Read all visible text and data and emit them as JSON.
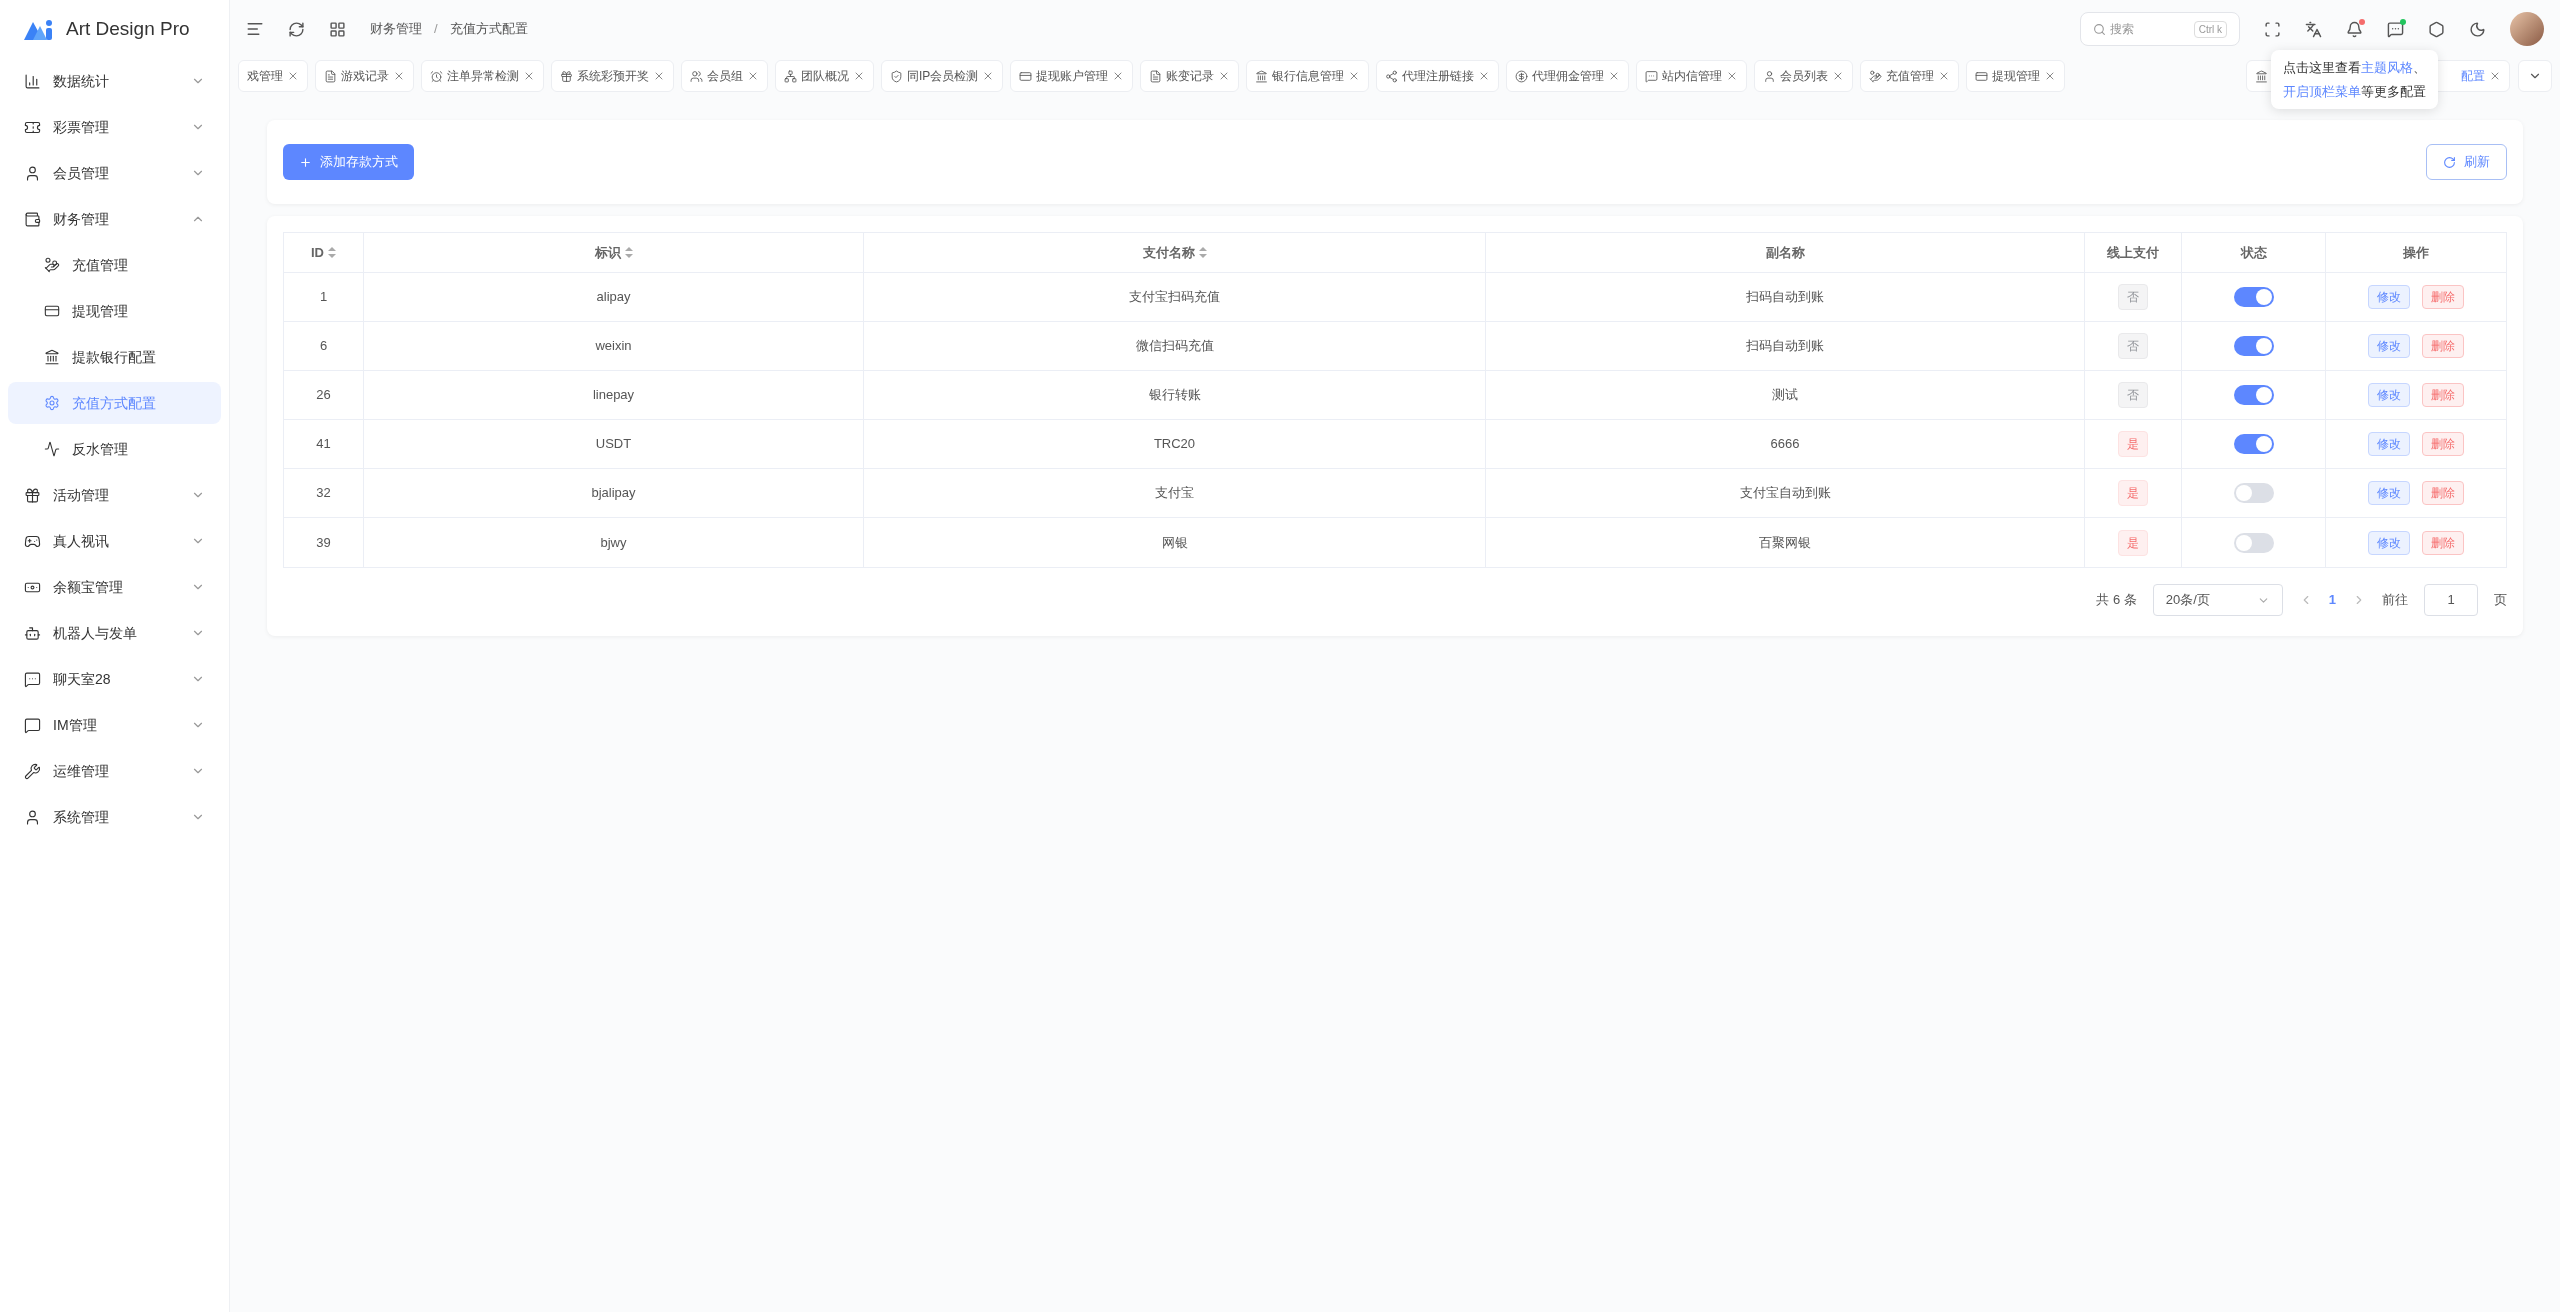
{
  "brand": {
    "name": "Art Design Pro"
  },
  "sidebar": {
    "items": [
      {
        "label": "数据统计",
        "expanded": false
      },
      {
        "label": "彩票管理",
        "expanded": false
      },
      {
        "label": "会员管理",
        "expanded": false
      },
      {
        "label": "财务管理",
        "expanded": true,
        "children": [
          {
            "label": "充值管理",
            "selected": false
          },
          {
            "label": "提现管理",
            "selected": false
          },
          {
            "label": "提款银行配置",
            "selected": false
          },
          {
            "label": "充值方式配置",
            "selected": true
          },
          {
            "label": "反水管理",
            "selected": false
          }
        ]
      },
      {
        "label": "活动管理",
        "expanded": false
      },
      {
        "label": "真人视讯",
        "expanded": false
      },
      {
        "label": "余额宝管理",
        "expanded": false
      },
      {
        "label": "机器人与发单",
        "expanded": false
      },
      {
        "label": "聊天室28",
        "expanded": false
      },
      {
        "label": "IM管理",
        "expanded": false
      },
      {
        "label": "运维管理",
        "expanded": false
      },
      {
        "label": "系统管理",
        "expanded": false
      }
    ]
  },
  "header": {
    "breadcrumb": [
      "财务管理",
      "充值方式配置"
    ],
    "separator": "/",
    "search": {
      "placeholder": "搜索",
      "shortcut": "Ctrl k"
    }
  },
  "tabs": [
    {
      "label": "戏管理",
      "selected": false
    },
    {
      "label": "游戏记录",
      "selected": false
    },
    {
      "label": "注单异常检测",
      "selected": false
    },
    {
      "label": "系统彩预开奖",
      "selected": false
    },
    {
      "label": "会员组",
      "selected": false
    },
    {
      "label": "团队概况",
      "selected": false
    },
    {
      "label": "同IP会员检测",
      "selected": false
    },
    {
      "label": "提现账户管理",
      "selected": false
    },
    {
      "label": "账变记录",
      "selected": false
    },
    {
      "label": "银行信息管理",
      "selected": false
    },
    {
      "label": "代理注册链接",
      "selected": false
    },
    {
      "label": "代理佣金管理",
      "selected": false
    },
    {
      "label": "站内信管理",
      "selected": false
    },
    {
      "label": "会员列表",
      "selected": false
    },
    {
      "label": "充值管理",
      "selected": false
    },
    {
      "label": "提现管理",
      "selected": false
    },
    {
      "selected": false
    },
    {
      "label": "配置",
      "selected": true
    }
  ],
  "tooltip": {
    "lines": [
      [
        {
          "text": "点击这里查看",
          "link": false
        },
        {
          "text": "主题风格",
          "link": true
        },
        {
          "text": "、",
          "link": false
        }
      ],
      [
        {
          "text": "开启顶栏菜单",
          "link": true
        },
        {
          "text": "等更多配置",
          "link": false
        }
      ]
    ]
  },
  "toolbar": {
    "add_button": "添加存款方式",
    "refresh_button": "刷新"
  },
  "table": {
    "columns": [
      {
        "label": "ID",
        "sortable": true
      },
      {
        "label": "标识",
        "sortable": true
      },
      {
        "label": "支付名称",
        "sortable": true
      },
      {
        "label": "副名称",
        "sortable": false
      },
      {
        "label": "线上支付",
        "sortable": false
      },
      {
        "label": "状态",
        "sortable": false
      },
      {
        "label": "操作",
        "sortable": false
      }
    ],
    "rows": [
      {
        "id": "1",
        "code": "alipay",
        "name": "支付宝扫码充值",
        "alias": "扫码自动到账",
        "online": {
          "label": "否",
          "on": false
        },
        "on": true,
        "actions": [
          "修改",
          "删除"
        ]
      },
      {
        "id": "6",
        "code": "weixin",
        "name": "微信扫码充值",
        "alias": "扫码自动到账",
        "online": {
          "label": "否",
          "on": false
        },
        "on": true,
        "actions": [
          "修改",
          "删除"
        ]
      },
      {
        "id": "26",
        "code": "linepay",
        "name": "银行转账",
        "alias": "测试",
        "online": {
          "label": "否",
          "on": false
        },
        "on": true,
        "actions": [
          "修改",
          "删除"
        ]
      },
      {
        "id": "41",
        "code": "USDT",
        "name": "TRC20",
        "alias": "6666",
        "online": {
          "label": "是",
          "on": true
        },
        "on": true,
        "actions": [
          "修改",
          "删除"
        ]
      },
      {
        "id": "32",
        "code": "bjalipay",
        "name": "支付宝",
        "alias": "支付宝自动到账",
        "online": {
          "label": "是",
          "on": true
        },
        "on": false,
        "actions": [
          "修改",
          "删除"
        ]
      },
      {
        "id": "39",
        "code": "bjwy",
        "name": "网银",
        "alias": "百聚网银",
        "online": {
          "label": "是",
          "on": true
        },
        "on": false,
        "actions": [
          "修改",
          "删除"
        ]
      }
    ]
  },
  "pagination": {
    "total": "共 6 条",
    "page_size": "20条/页",
    "pages": [
      {
        "label": "1",
        "selected": true
      }
    ],
    "goto_label": "前往",
    "goto_value": "1",
    "suffix": "页"
  }
}
